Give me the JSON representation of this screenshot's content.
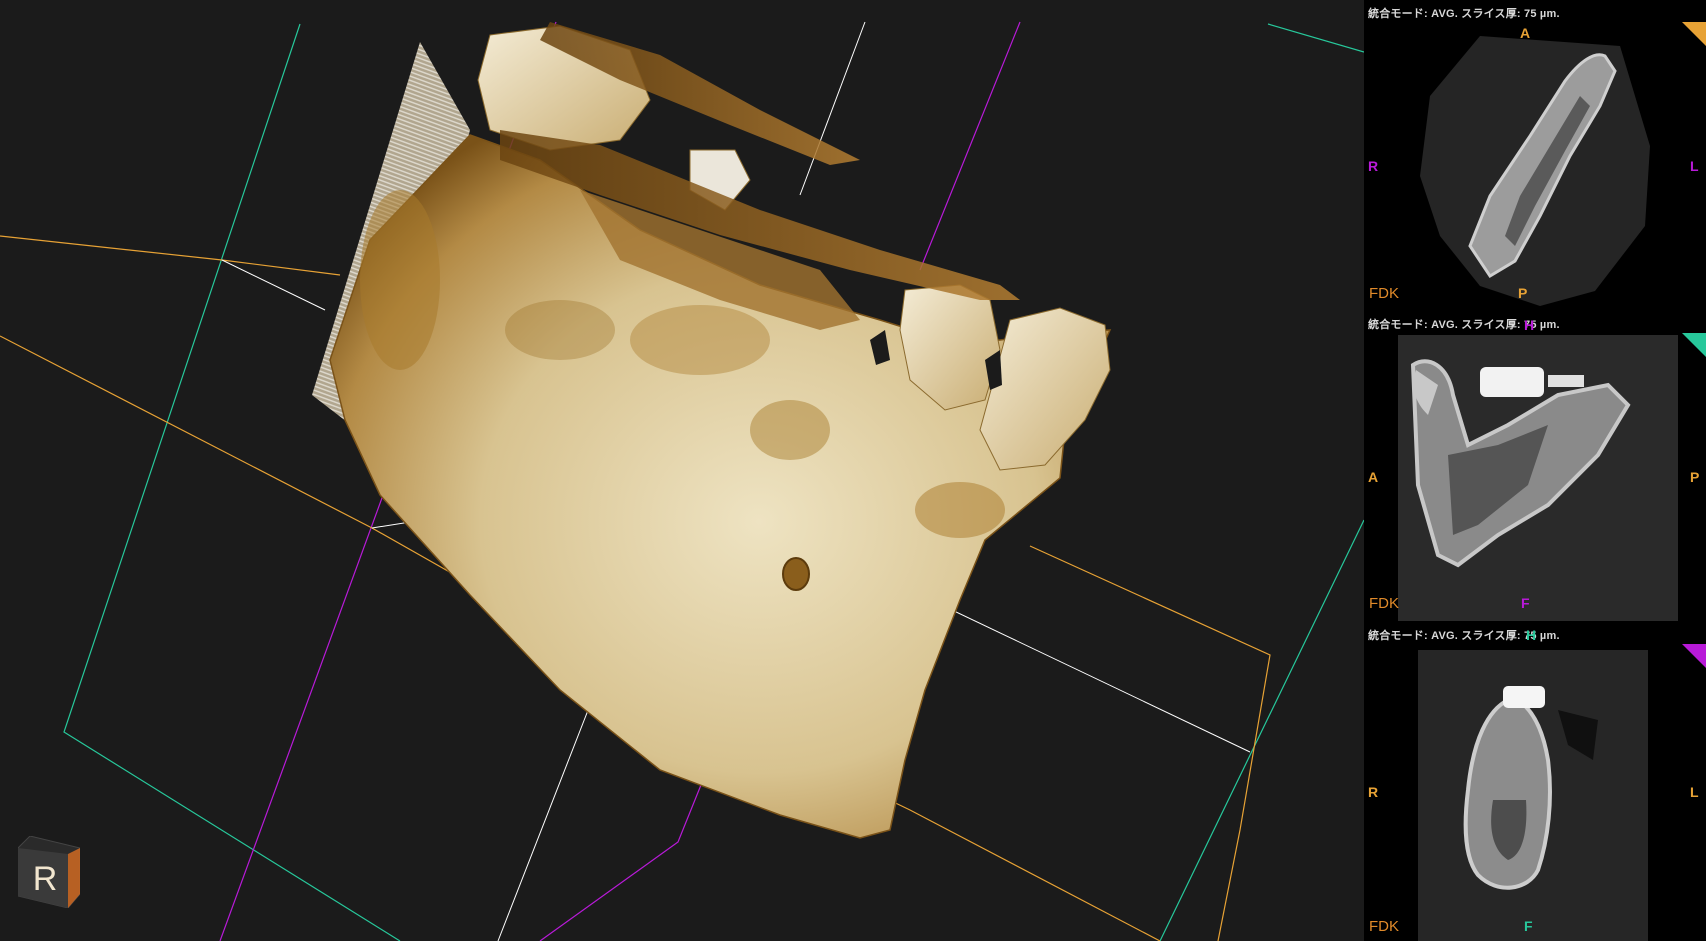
{
  "viewport3d": {
    "orientation_cube_label": "R",
    "colors": {
      "axial": "#e7a235",
      "sagittal": "#b81ad8",
      "coronal": "#27c89b",
      "reference": "#ffffff"
    }
  },
  "panels": [
    {
      "mode_label": "統合モード: AVG. スライス厚: 75 µm.",
      "recon_label": "FDK",
      "top_label": "A",
      "bottom_label": "P",
      "left_label": "R",
      "right_label": "L",
      "accent": "#e7a235",
      "top_color": "#27c89b",
      "side_color": "#b81ad8"
    },
    {
      "mode_label": "統合モード: AVG. スライス厚: 75 µm.",
      "recon_label": "FDK",
      "top_label": "H",
      "bottom_label": "F",
      "left_label": "A",
      "right_label": "P",
      "accent": "#27c89b",
      "top_color": "#b81ad8",
      "side_color": "#e7a235"
    },
    {
      "mode_label": "統合モード: AVG. スライス厚: 75 µm.",
      "recon_label": "FDK",
      "top_label": "H",
      "bottom_label": "F",
      "left_label": "R",
      "right_label": "L",
      "accent": "#b81ad8",
      "top_color": "#27c89b",
      "side_color": "#e7a235"
    }
  ]
}
